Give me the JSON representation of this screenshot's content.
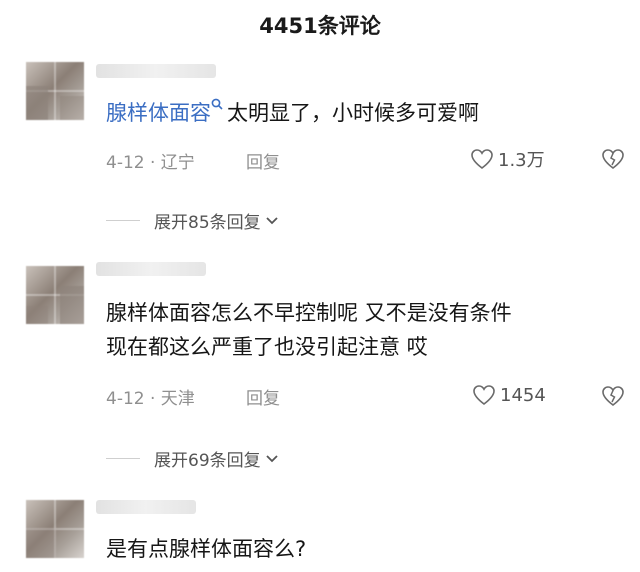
{
  "header": {
    "title": "4451条评论"
  },
  "comments": [
    {
      "highlight": "腺样体面容",
      "text_line1": "太明显了，小时候多可爱啊",
      "text_line2": "",
      "date_location": "4-12 · 辽宁",
      "reply_label": "回复",
      "likes": "1.3万",
      "expand_label": "展开85条回复"
    },
    {
      "highlight": "",
      "text_line1": "腺样体面容怎么不早控制呢 又不是没有条件",
      "text_line2": "现在都这么严重了也没引起注意 哎",
      "date_location": "4-12 · 天津",
      "reply_label": "回复",
      "likes": "1454",
      "expand_label": "展开69条回复"
    },
    {
      "highlight": "",
      "text_line1": "是有点腺样体面容么?",
      "text_line2": ""
    }
  ]
}
